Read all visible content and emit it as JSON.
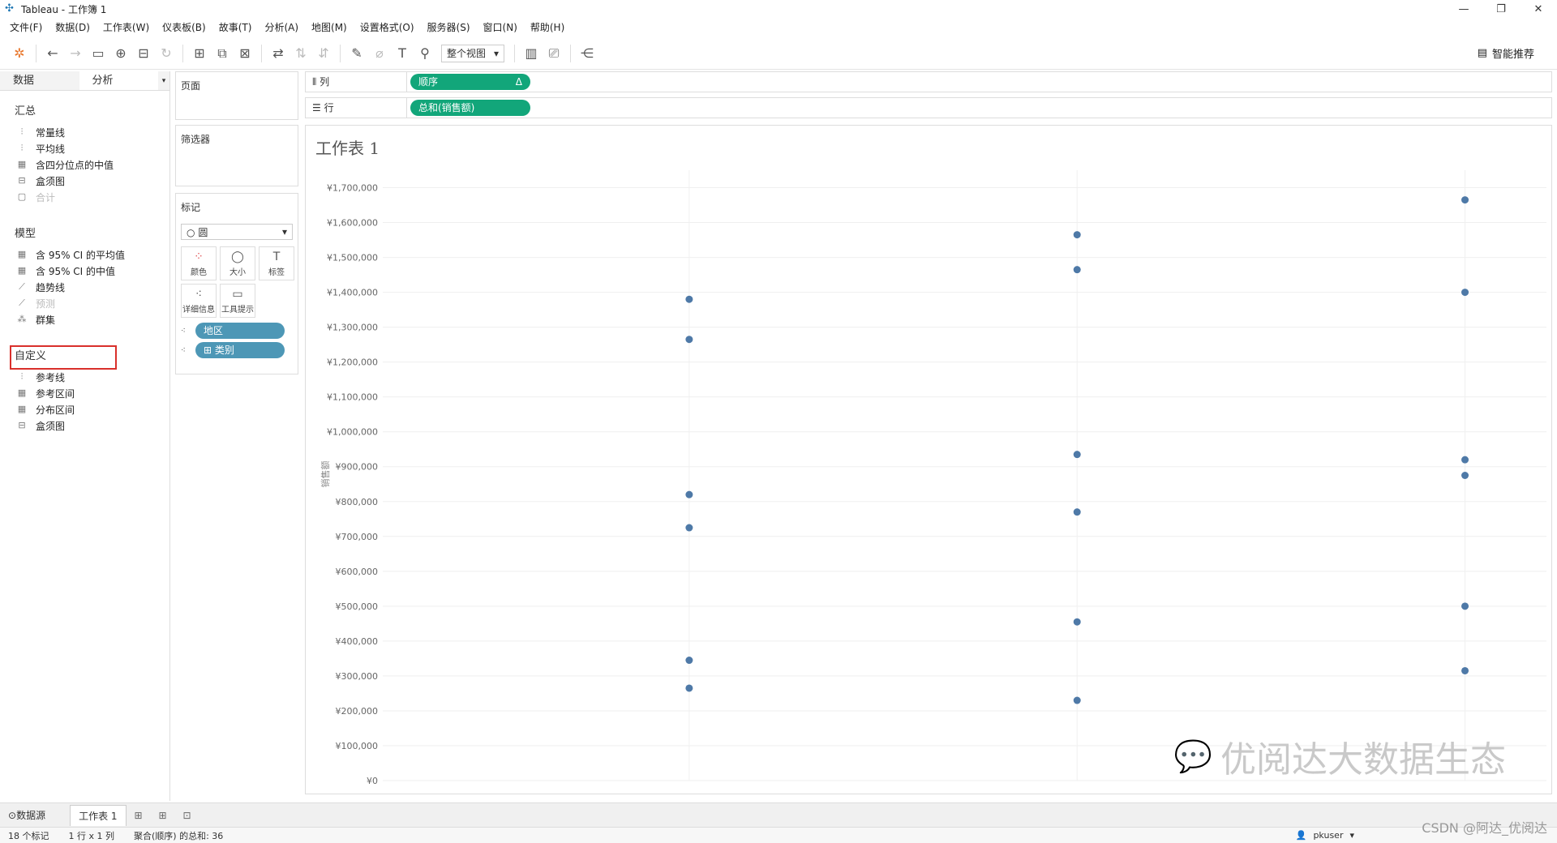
{
  "window": {
    "title": "Tableau - 工作簿 1"
  },
  "menu": [
    "文件(F)",
    "数据(D)",
    "工作表(W)",
    "仪表板(B)",
    "故事(T)",
    "分析(A)",
    "地图(M)",
    "设置格式(O)",
    "服务器(S)",
    "窗口(N)",
    "帮助(H)"
  ],
  "toolbar": {
    "fit_select": "整个视图",
    "smart_label": "智能推荐"
  },
  "left_panel": {
    "tabs": [
      "数据",
      "分析"
    ],
    "sections": [
      {
        "title": "汇总",
        "items": [
          {
            "label": "常量线",
            "icon": "ref-line-icon",
            "enabled": true
          },
          {
            "label": "平均线",
            "icon": "ref-line-icon",
            "enabled": true
          },
          {
            "label": "含四分位点的中值",
            "icon": "band-icon",
            "enabled": true
          },
          {
            "label": "盒须图",
            "icon": "boxplot-icon",
            "enabled": true
          },
          {
            "label": "合计",
            "icon": "total-icon",
            "enabled": false
          }
        ]
      },
      {
        "title": "模型",
        "items": [
          {
            "label": "含 95% CI 的平均值",
            "icon": "band-icon",
            "enabled": true
          },
          {
            "label": "含 95% CI 的中值",
            "icon": "band-icon",
            "enabled": true
          },
          {
            "label": "趋势线",
            "icon": "trend-icon",
            "enabled": true
          },
          {
            "label": "预测",
            "icon": "forecast-icon",
            "enabled": false
          },
          {
            "label": "群集",
            "icon": "cluster-icon",
            "enabled": true
          }
        ]
      },
      {
        "title": "自定义",
        "items": [
          {
            "label": "参考线",
            "icon": "ref-line-icon",
            "enabled": true
          },
          {
            "label": "参考区间",
            "icon": "band-icon",
            "enabled": true
          },
          {
            "label": "分布区间",
            "icon": "band-icon",
            "enabled": true
          },
          {
            "label": "盒须图",
            "icon": "boxplot-icon",
            "enabled": true
          }
        ]
      }
    ]
  },
  "pages_card": {
    "title": "页面"
  },
  "filters_card": {
    "title": "筛选器"
  },
  "marks_card": {
    "title": "标记",
    "type": "圆",
    "buttons": [
      "颜色",
      "大小",
      "标签",
      "详细信息",
      "工具提示"
    ],
    "fields": [
      "地区",
      "类别"
    ]
  },
  "shelves": {
    "columns": {
      "label": "列",
      "pill": "顺序",
      "pill_suffix": "Δ"
    },
    "rows": {
      "label": "行",
      "pill": "总和(销售额)"
    }
  },
  "sheet_title": "工作表 1",
  "chart_data": {
    "type": "scatter",
    "ylabel": "销售额",
    "ylim": [
      0,
      1750000
    ],
    "yticks": [
      0,
      100000,
      200000,
      300000,
      400000,
      500000,
      600000,
      700000,
      800000,
      900000,
      1000000,
      1100000,
      1200000,
      1300000,
      1400000,
      1500000,
      1600000,
      1700000
    ],
    "ytick_labels": [
      "¥0",
      "¥100,000",
      "¥200,000",
      "¥300,000",
      "¥400,000",
      "¥500,000",
      "¥600,000",
      "¥700,000",
      "¥800,000",
      "¥900,000",
      "¥1,000,000",
      "¥1,100,000",
      "¥1,200,000",
      "¥1,300,000",
      "¥1,400,000",
      "¥1,500,000",
      "¥1,600,000",
      "¥1,700,000"
    ],
    "columns": 3,
    "points": [
      {
        "col": 1,
        "y": 1380000
      },
      {
        "col": 1,
        "y": 1265000
      },
      {
        "col": 1,
        "y": 820000
      },
      {
        "col": 1,
        "y": 725000
      },
      {
        "col": 1,
        "y": 345000
      },
      {
        "col": 1,
        "y": 265000
      },
      {
        "col": 2,
        "y": 1565000
      },
      {
        "col": 2,
        "y": 1465000
      },
      {
        "col": 2,
        "y": 935000
      },
      {
        "col": 2,
        "y": 770000
      },
      {
        "col": 2,
        "y": 455000
      },
      {
        "col": 2,
        "y": 230000
      },
      {
        "col": 3,
        "y": 1665000
      },
      {
        "col": 3,
        "y": 1400000
      },
      {
        "col": 3,
        "y": 920000
      },
      {
        "col": 3,
        "y": 875000
      },
      {
        "col": 3,
        "y": 500000
      },
      {
        "col": 3,
        "y": 315000
      }
    ],
    "color": "#4e79a7",
    "grid": true
  },
  "watermark": "优阅达大数据生态",
  "bottom_tabs": {
    "datasource": "数据源",
    "sheet": "工作表 1"
  },
  "status": {
    "marks": "18 个标记",
    "rows_cols": "1 行 x 1 列",
    "sum": "聚合(顺序) 的总和: 36",
    "user": "pkuser"
  },
  "csdn_mark": "CSDN @阿达_优阅达"
}
